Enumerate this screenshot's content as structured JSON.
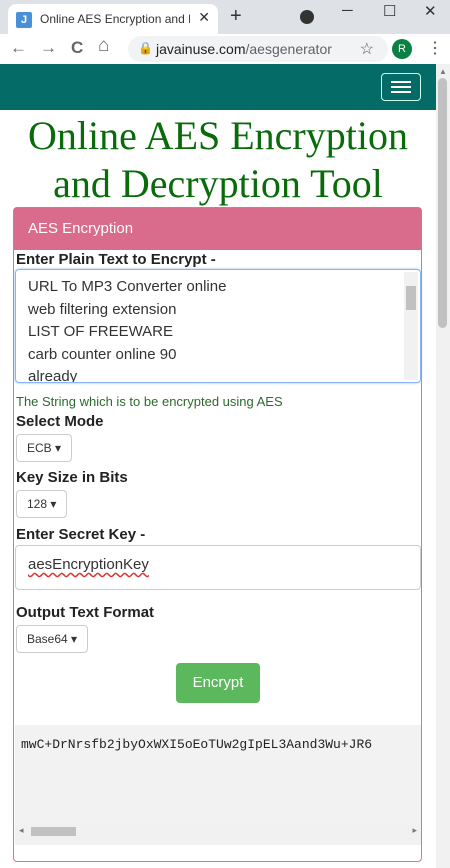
{
  "browser": {
    "tab_title": "Online AES Encryption and Dec",
    "favicon_letter": "J",
    "tab_close": "✕",
    "new_tab": "+",
    "minimize": "─",
    "maximize": "☐",
    "close": "✕",
    "back": "←",
    "forward": "→",
    "reload": "C",
    "home": "⌂",
    "url_domain": "javainuse.com",
    "url_path": "/aesgenerator",
    "bookmark": "☆",
    "avatar_letter": "R",
    "menu": "⋮"
  },
  "page": {
    "title": "Online AES Encryption and Decryption Tool",
    "panel_heading": "AES Encryption",
    "plain_label": "Enter Plain Text to Encrypt -",
    "plain_lines": [
      "URL To MP3 Converter online",
      "web filtering extension",
      "LIST OF FREEWARE",
      "carb counter online 90",
      "already"
    ],
    "plain_help": "The String which is to be encrypted using AES",
    "mode_label": "Select Mode",
    "mode_value": "ECB",
    "keysize_label": "Key Size in Bits",
    "keysize_value": "128",
    "secret_label": "Enter Secret Key -",
    "secret_value": "aesEncryptionKey",
    "format_label": "Output Text Format",
    "format_value": "Base64",
    "encrypt_button": "Encrypt",
    "output": "mwC+DrNrsfb2jbyOxWXI5oEoTUw2gIpEL3Aand3Wu+JR6"
  },
  "colors": {
    "navbar": "#046b67",
    "title": "#0a6b0a",
    "panel_header": "#d96b8c",
    "encrypt_button": "#5cb85c"
  }
}
